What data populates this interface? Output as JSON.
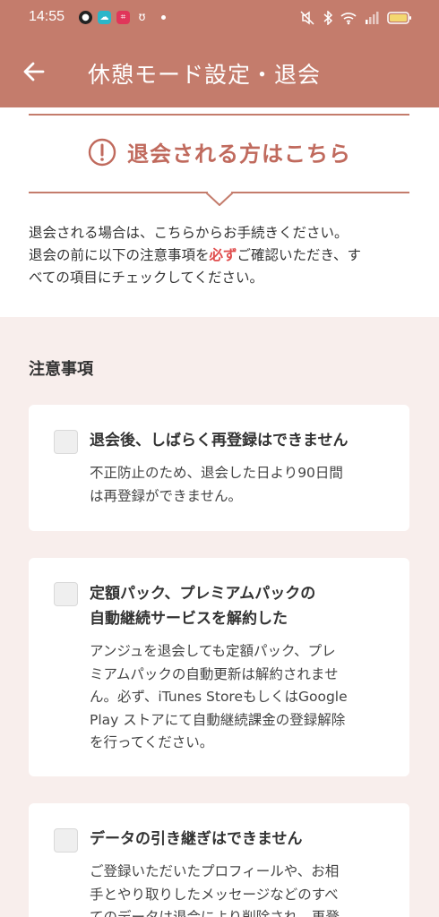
{
  "status_bar": {
    "time": "14:55",
    "notification_icons": [
      {
        "name": "chat-bubble-icon",
        "color": "#222222",
        "glyph": "●"
      },
      {
        "name": "cloud-app-icon",
        "color": "#2bb6c9",
        "glyph": "☁"
      },
      {
        "name": "crop-app-icon",
        "color": "#e0365a",
        "glyph": "⌗"
      },
      {
        "name": "bunny-app-icon",
        "color": "#c47c6c",
        "glyph": "ʊ"
      }
    ]
  },
  "app_bar": {
    "title": "休憩モード設定・退会"
  },
  "withdraw": {
    "heading": "退会される方はこちら",
    "intro_line1": "退会される場合は、こちらからお手続きください。",
    "intro_line2_pre": "退会の前に以下の注意事項を",
    "intro_line2_em": "必ず",
    "intro_line2_post": "ご確認いただき、す",
    "intro_line3": "べての項目にチェックしてください。"
  },
  "notes": {
    "section_title": "注意事項",
    "items": [
      {
        "title_lines": [
          "退会後、しばらく再登録はできません"
        ],
        "body_lines": [
          "不正防止のため、退会した日より90日間",
          "は再登録ができません。"
        ]
      },
      {
        "title_lines": [
          "定額パック、プレミアムパックの",
          "自動継続サービスを解約した"
        ],
        "body_lines": [
          "アンジュを退会しても定額パック、プレ",
          "ミアムパックの自動更新は解約されませ",
          "ん。必ず、iTunes StoreもしくはGoogle",
          "Play ストアにて自動継続課金の登録解除",
          "を行ってください。"
        ]
      },
      {
        "title_lines": [
          "データの引き継ぎはできません"
        ],
        "body_lines": [
          "ご登録いただいたプロフィールや、お相",
          "手とやり取りしたメッセージなどのすべ",
          "てのデータは退会により削除され、再登"
        ]
      }
    ]
  },
  "colors": {
    "brand": "#c47c6c",
    "accent_text": "#c06a5d",
    "emphasis": "#e04d4d",
    "pink_bg": "#f8eeec"
  }
}
